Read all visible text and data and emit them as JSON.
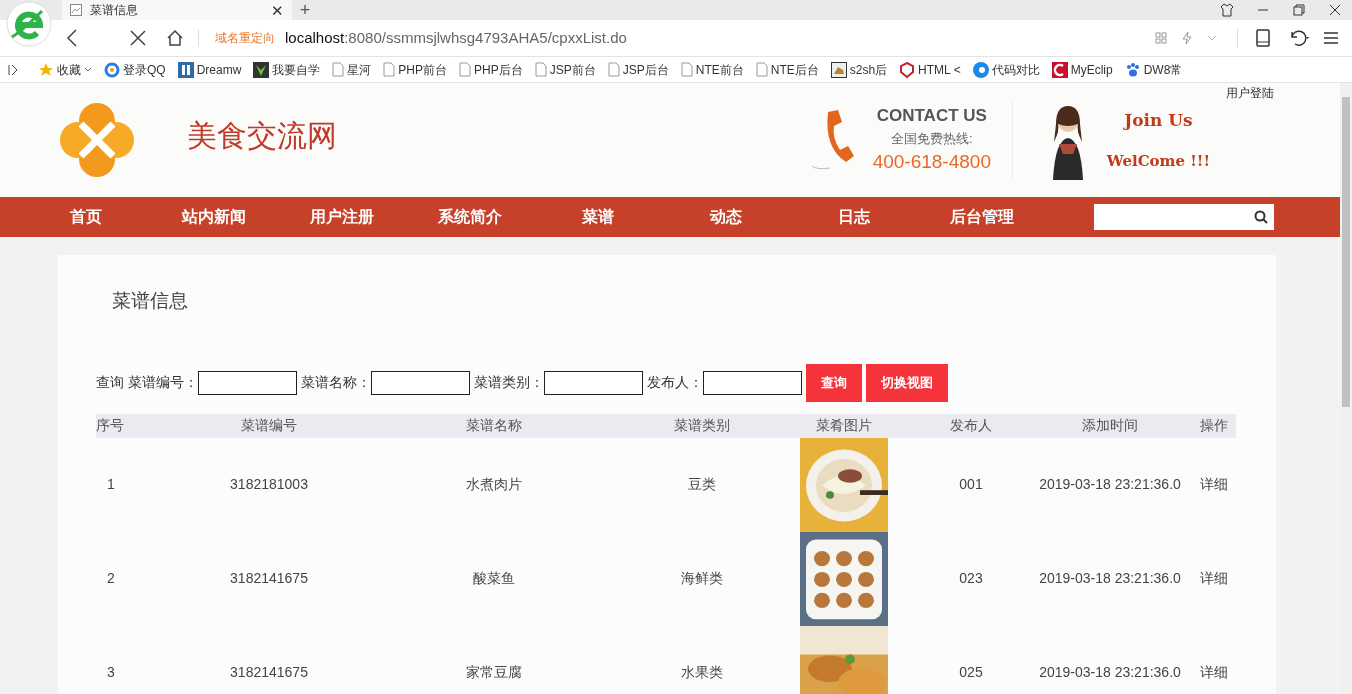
{
  "browser": {
    "tab_title": "菜谱信息",
    "tab_close": "✕",
    "new_tab": "+",
    "redirect_label": "域名重定向",
    "url_host": "localhost",
    "url_rest": ":8080/ssmmsjlwhsg4793AHA5/cpxxList.do",
    "bookmarks": [
      {
        "label": "收藏",
        "kind": "star"
      },
      {
        "label": "登录QQ",
        "kind": "qq"
      },
      {
        "label": "Dreamw",
        "kind": "dw"
      },
      {
        "label": "我要自学",
        "kind": "leaf"
      },
      {
        "label": "星河",
        "kind": "page"
      },
      {
        "label": "PHP前台",
        "kind": "page"
      },
      {
        "label": "PHP后台",
        "kind": "page"
      },
      {
        "label": "JSP前台",
        "kind": "page"
      },
      {
        "label": "JSP后台",
        "kind": "page"
      },
      {
        "label": "NTE前台",
        "kind": "page"
      },
      {
        "label": "NTE后台",
        "kind": "page"
      },
      {
        "label": "s2sh后",
        "kind": "cat"
      },
      {
        "label": "HTML <",
        "kind": "html"
      },
      {
        "label": "代码对比",
        "kind": "c"
      },
      {
        "label": "MyEclip",
        "kind": "myeclipse"
      },
      {
        "label": "DW8常",
        "kind": "paw"
      }
    ]
  },
  "header": {
    "login_link": "用户登陆",
    "site_title": "美食交流网",
    "contact_title": "CONTACT US",
    "hotline_label": "全国免费热线:",
    "phone": "400-618-4800",
    "join_line": "Join Us",
    "welcome_line": "WelCome !!!"
  },
  "nav": {
    "items": [
      {
        "label": "首页"
      },
      {
        "label": "站内新闻"
      },
      {
        "label": "用户注册"
      },
      {
        "label": "系统简介"
      },
      {
        "label": "菜谱"
      },
      {
        "label": "动态"
      },
      {
        "label": "日志"
      },
      {
        "label": "后台管理"
      }
    ]
  },
  "content": {
    "title": "菜谱信息",
    "filters": {
      "prefix": "查询",
      "fields": [
        {
          "label": "菜谱编号："
        },
        {
          "label": "菜谱名称："
        },
        {
          "label": "菜谱类别："
        },
        {
          "label": "发布人："
        }
      ],
      "buttons": [
        "查询",
        "切换视图"
      ]
    },
    "table": {
      "columns": [
        "序号",
        "菜谱编号",
        "菜谱名称",
        "菜谱类别",
        "菜肴图片",
        "发布人",
        "添加时间",
        "操作"
      ],
      "rows": [
        {
          "index": "1",
          "code": "3182181003",
          "name": "水煮肉片",
          "category": "豆类",
          "publisher": "001",
          "time": "2019-03-18 23:21:36.0",
          "action": "详细"
        },
        {
          "index": "2",
          "code": "3182141675",
          "name": "酸菜鱼",
          "category": "海鲜类",
          "publisher": "023",
          "time": "2019-03-18 23:21:36.0",
          "action": "详细"
        },
        {
          "index": "3",
          "code": "3182141675",
          "name": "家常豆腐",
          "category": "水果类",
          "publisher": "025",
          "time": "2019-03-18 23:21:36.0",
          "action": "详细"
        }
      ]
    }
  }
}
